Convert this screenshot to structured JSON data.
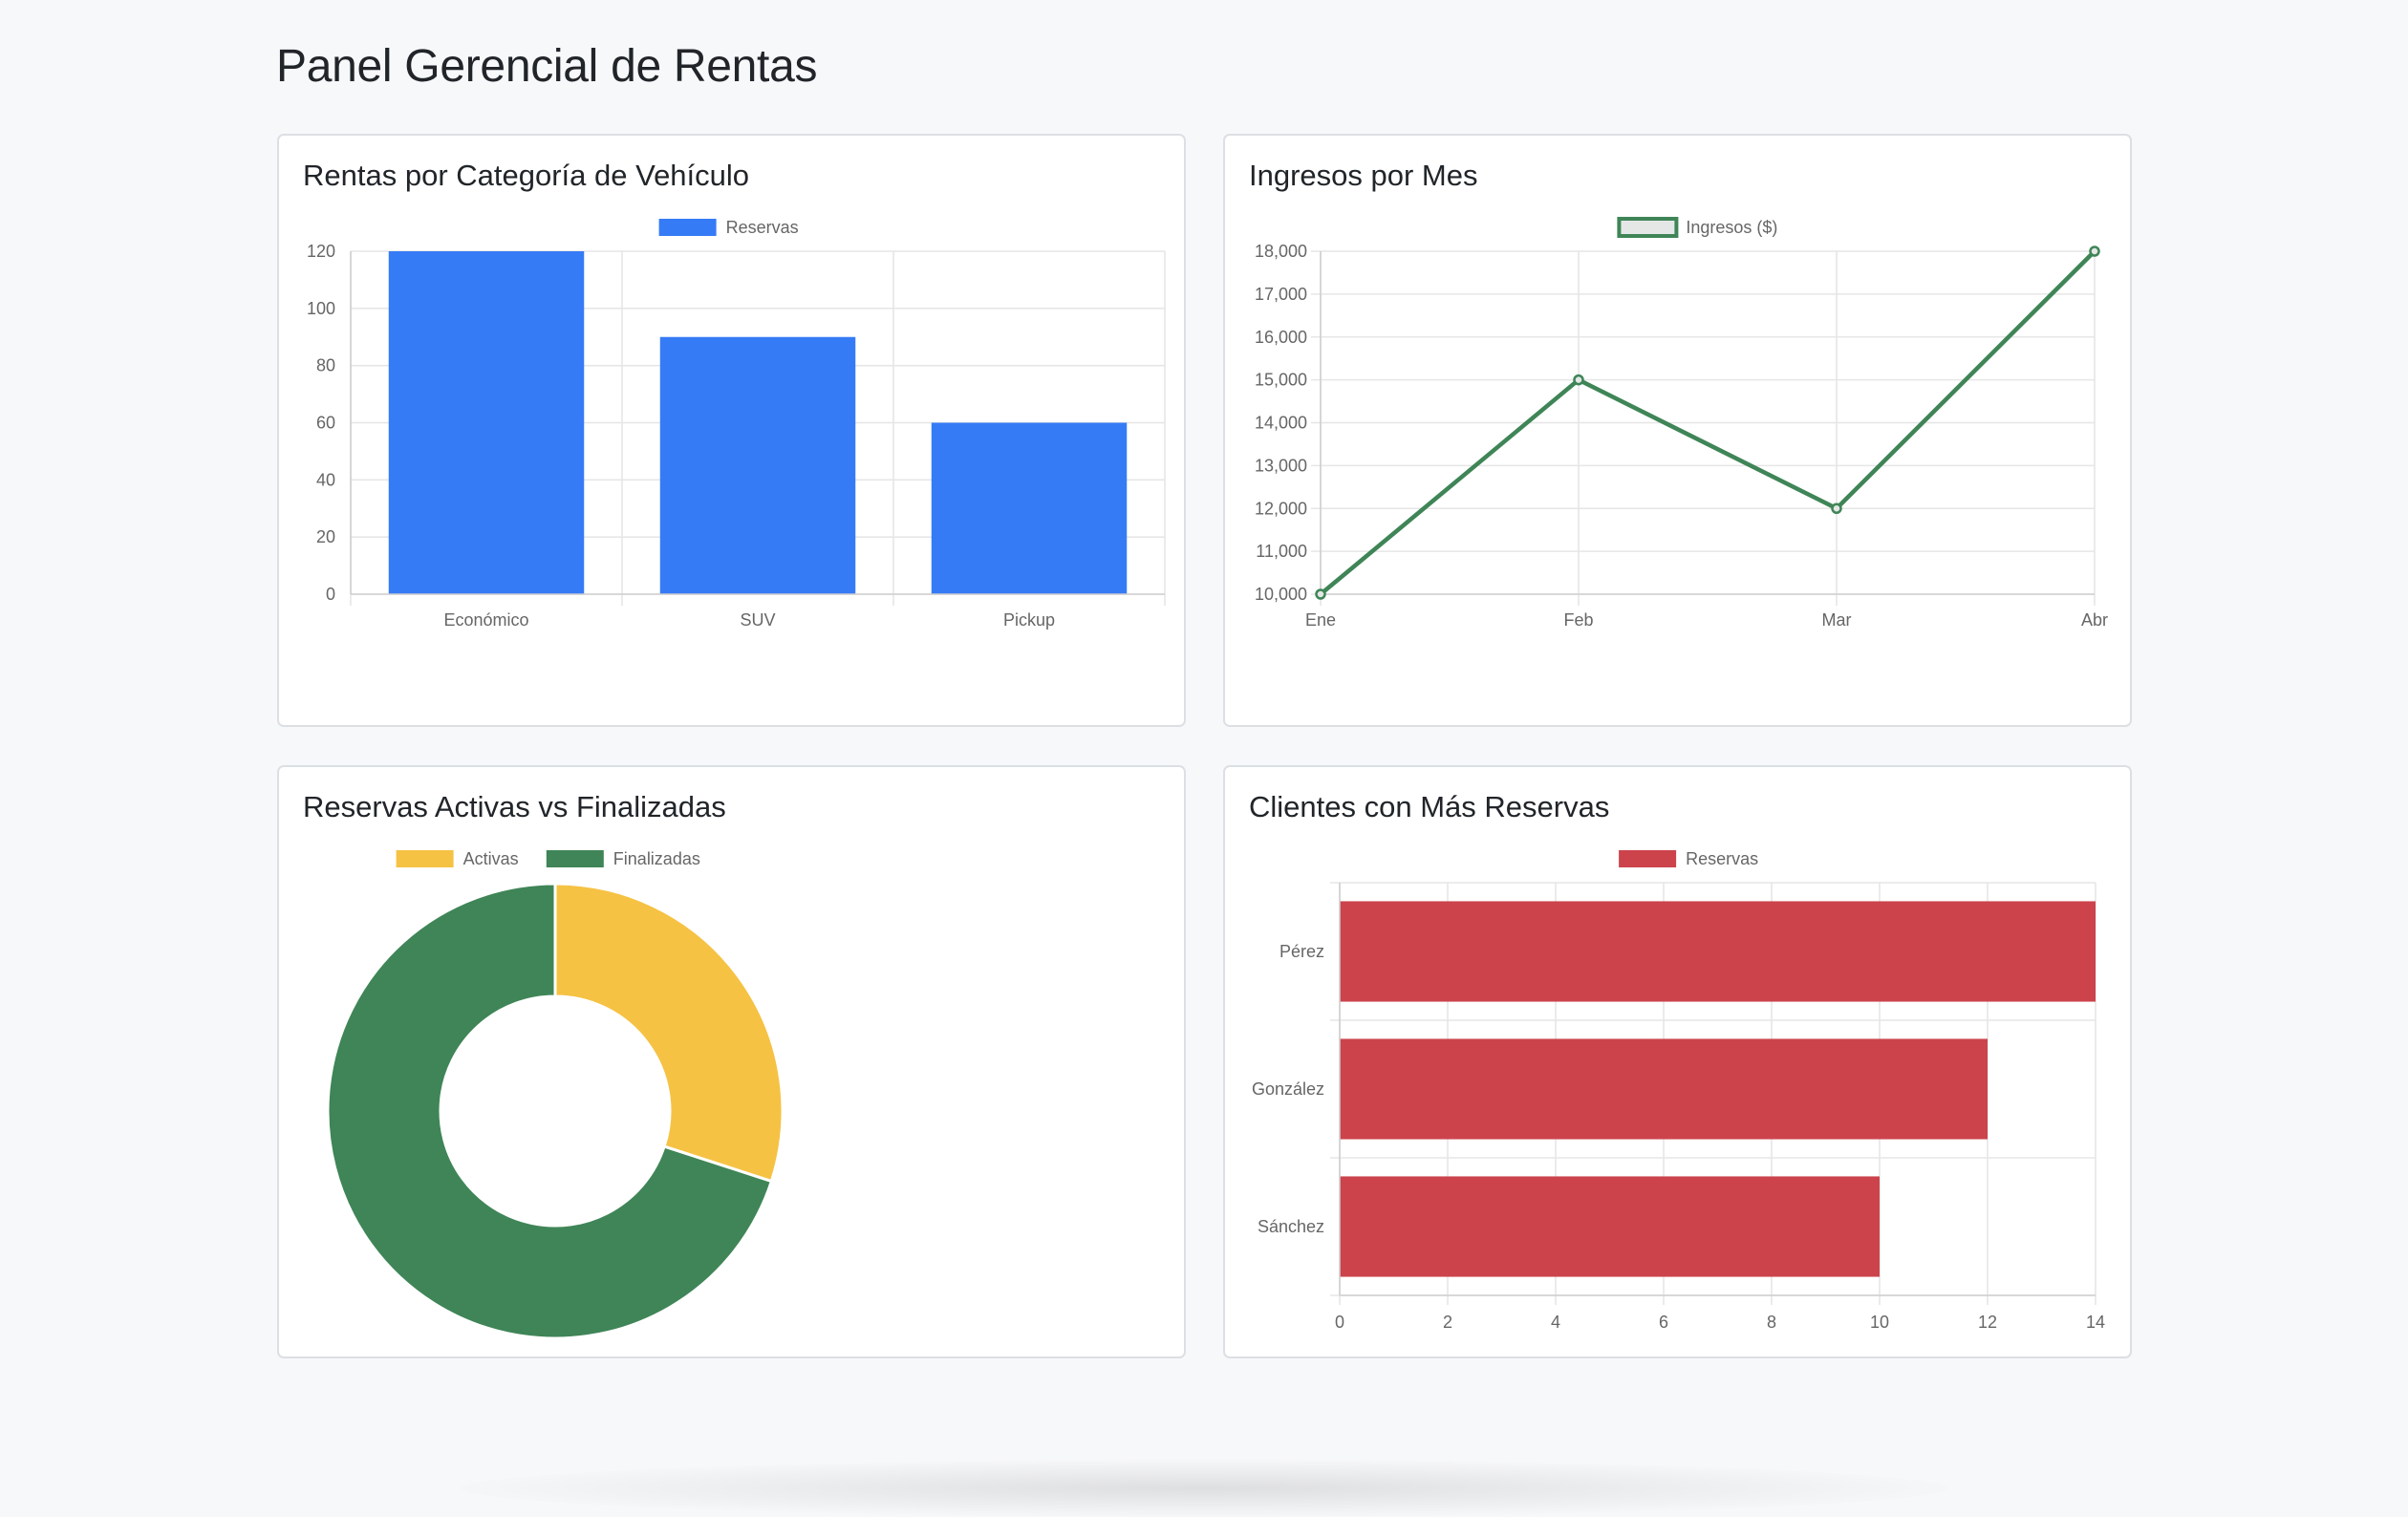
{
  "page": {
    "title": "Panel Gerencial de Rentas"
  },
  "cards": [
    {
      "title": "Rentas por Categoría de Vehículo"
    },
    {
      "title": "Ingresos por Mes"
    },
    {
      "title": "Reservas Activas vs Finalizadas"
    },
    {
      "title": "Clientes con Más Reservas"
    }
  ],
  "colors": {
    "blue": "#367bf6",
    "green": "#3f8557",
    "yellow": "#f5c244",
    "red": "#cc434c",
    "line_fill": "#e4e7e6"
  },
  "chart_data": [
    {
      "type": "bar",
      "title": "Rentas por Categoría de Vehículo",
      "categories": [
        "Económico",
        "SUV",
        "Pickup"
      ],
      "series": [
        {
          "name": "Reservas",
          "values": [
            120,
            90,
            60
          ],
          "color": "#367bf6"
        }
      ],
      "ylim": [
        0,
        120
      ],
      "yticks": [
        0,
        20,
        40,
        60,
        80,
        100,
        120
      ],
      "grid": true,
      "legend": "top-center"
    },
    {
      "type": "line",
      "title": "Ingresos por Mes",
      "categories": [
        "Ene",
        "Feb",
        "Mar",
        "Abr"
      ],
      "series": [
        {
          "name": "Ingresos ($)",
          "values": [
            10000,
            15000,
            12000,
            18000
          ],
          "color": "#3f8557"
        }
      ],
      "ylim": [
        10000,
        18000
      ],
      "yticks": [
        "10,000",
        "11,000",
        "12,000",
        "13,000",
        "14,000",
        "15,000",
        "16,000",
        "17,000",
        "18,000"
      ],
      "grid": true,
      "legend": "top-center"
    },
    {
      "type": "pie",
      "title": "Reservas Activas vs Finalizadas",
      "labels": [
        "Activas",
        "Finalizadas"
      ],
      "values": [
        30,
        70
      ],
      "colors": [
        "#f5c244",
        "#3f8557"
      ],
      "legend": "top-center"
    },
    {
      "type": "bar",
      "orientation": "horizontal",
      "title": "Clientes con Más Reservas",
      "categories": [
        "Pérez",
        "González",
        "Sánchez"
      ],
      "series": [
        {
          "name": "Reservas",
          "values": [
            14,
            12,
            10
          ],
          "color": "#cc434c"
        }
      ],
      "xlim": [
        0,
        14
      ],
      "xticks": [
        0,
        2,
        4,
        6,
        8,
        10,
        12,
        14
      ],
      "grid": true,
      "legend": "top-center"
    }
  ]
}
